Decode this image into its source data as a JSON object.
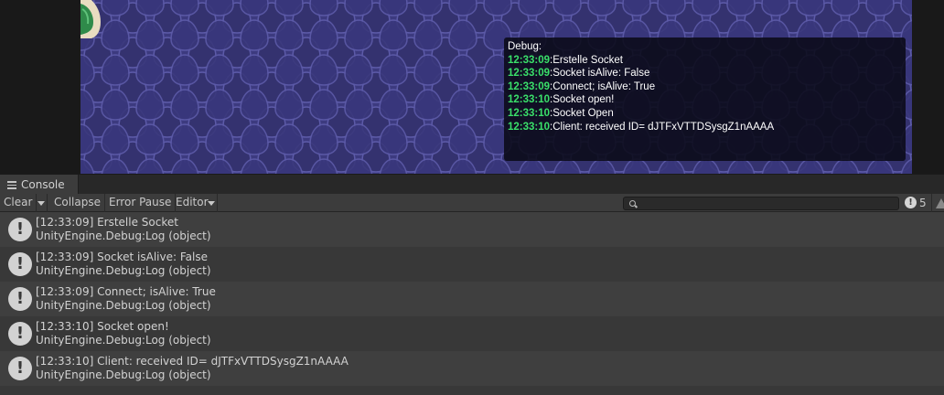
{
  "debug_overlay": {
    "title": "Debug:",
    "lines": [
      {
        "time": "12:33:09",
        "text": ":Erstelle Socket"
      },
      {
        "time": "12:33:09",
        "text": ":Socket isAlive: False"
      },
      {
        "time": "12:33:09",
        "text": ":Connect; isAlive: True"
      },
      {
        "time": "12:33:10",
        "text": ":Socket open!"
      },
      {
        "time": "12:33:10",
        "text": ":Socket Open"
      },
      {
        "time": "12:33:10",
        "text": ":Client: received ID= dJTFxVTTDSysgZ1nAAAA"
      }
    ]
  },
  "console": {
    "tab_label": "Console",
    "toolbar": {
      "clear": "Clear",
      "collapse": "Collapse",
      "error_pause": "Error Pause",
      "editor": "Editor",
      "search_placeholder": "",
      "info_count": "5"
    },
    "entries": [
      {
        "message": "[12:33:09] Erstelle Socket",
        "source": "UnityEngine.Debug:Log (object)"
      },
      {
        "message": "[12:33:09] Socket isAlive: False",
        "source": "UnityEngine.Debug:Log (object)"
      },
      {
        "message": "[12:33:09] Connect; isAlive: True",
        "source": "UnityEngine.Debug:Log (object)"
      },
      {
        "message": "[12:33:10] Socket open!",
        "source": "UnityEngine.Debug:Log (object)"
      },
      {
        "message": "[12:33:10] Client: received ID= dJTFxVTTDSysgZ1nAAAA",
        "source": "UnityEngine.Debug:Log (object)"
      }
    ]
  },
  "colors": {
    "game_background": "#3c3a7f",
    "timestamp_green": "#3ae06a",
    "editor_panel": "#383838"
  },
  "icons": {
    "log_entry": "info-icon",
    "tab": "console-icon",
    "search": "search-icon",
    "warning": "warning-icon"
  }
}
